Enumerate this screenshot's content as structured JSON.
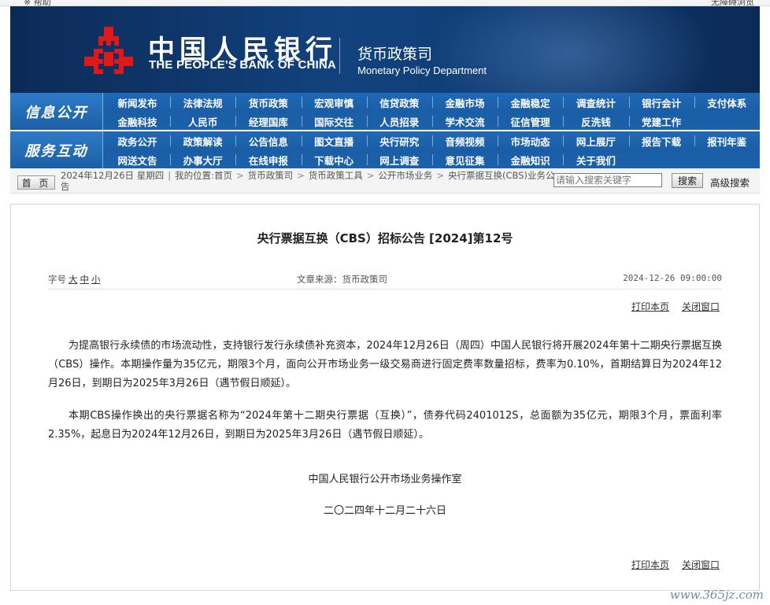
{
  "top_strip": {
    "left_text": "※ 帮助",
    "right_text": "无障碍浏览"
  },
  "banner": {
    "bank_name_cn": "中国人民银行",
    "bank_name_en": "THE PEOPLE'S BANK OF CHINA",
    "dept_cn": "货币政策司",
    "dept_en": "Monetary Policy Department",
    "logo_color": "#e01818"
  },
  "nav": {
    "row1_label": "信息公开",
    "row2_label": "服务互动",
    "row1_items": [
      "新闻发布",
      "法律法规",
      "货币政策",
      "宏观审慎",
      "信贷政策",
      "金融市场",
      "金融稳定",
      "调查统计",
      "银行会计",
      "支付体系",
      "金融科技",
      "人民币",
      "经理国库",
      "国际交往",
      "人员招录",
      "学术交流",
      "征信管理",
      "反洗钱",
      "党建工作"
    ],
    "row2_items": [
      "政务公开",
      "政策解读",
      "公告信息",
      "图文直播",
      "央行研究",
      "音频视频",
      "市场动态",
      "网上展厅",
      "报告下载",
      "报刊年鉴",
      "网送文告",
      "办事大厅",
      "在线申报",
      "下载中心",
      "网上调查",
      "意见征集",
      "金融知识",
      "关于我们"
    ]
  },
  "breadcrumb": {
    "home_label": "首 页",
    "date": "2024年12月26日 星期四",
    "location_label": "我的位置:首页",
    "path": [
      "货币政策司",
      "货币政策工具",
      "公开市场业务",
      "央行票据互换(CBS)业务公告"
    ],
    "search_placeholder": "请输入搜索关键字",
    "search_button": "搜索",
    "advanced_search": "高级搜索"
  },
  "article": {
    "title": "央行票据互换（CBS）招标公告 [2024]第12号",
    "font_size_label": "字号",
    "font_sizes": [
      "大",
      "中",
      "小"
    ],
    "source": "文章来源：货币政策司",
    "datetime": "2024-12-26 09:00:00",
    "print_label": "打印本页",
    "close_label": "关闭窗口",
    "paragraph1": "为提高银行永续债的市场流动性，支持银行发行永续债补充资本，2024年12月26日（周四）中国人民银行将开展2024年第十二期央行票据互换（CBS）操作。本期操作量为35亿元，期限3个月，面向公开市场业务一级交易商进行固定费率数量招标，费率为0.10%，首期结算日为2024年12月26日，到期日为2025年3月26日（遇节假日顺延）。",
    "paragraph2": "本期CBS操作换出的央行票据名称为“2024年第十二期央行票据（互换）”，债券代码2401012S，总面额为35亿元，期限3个月，票面利率2.35%，起息日为2024年12月26日，到期日为2025年3月26日（遇节假日顺延）。",
    "signature": "中国人民银行公开市场业务操作室",
    "sign_date": "二〇二四年十二月二十六日"
  },
  "watermark": "www.365jz.com"
}
